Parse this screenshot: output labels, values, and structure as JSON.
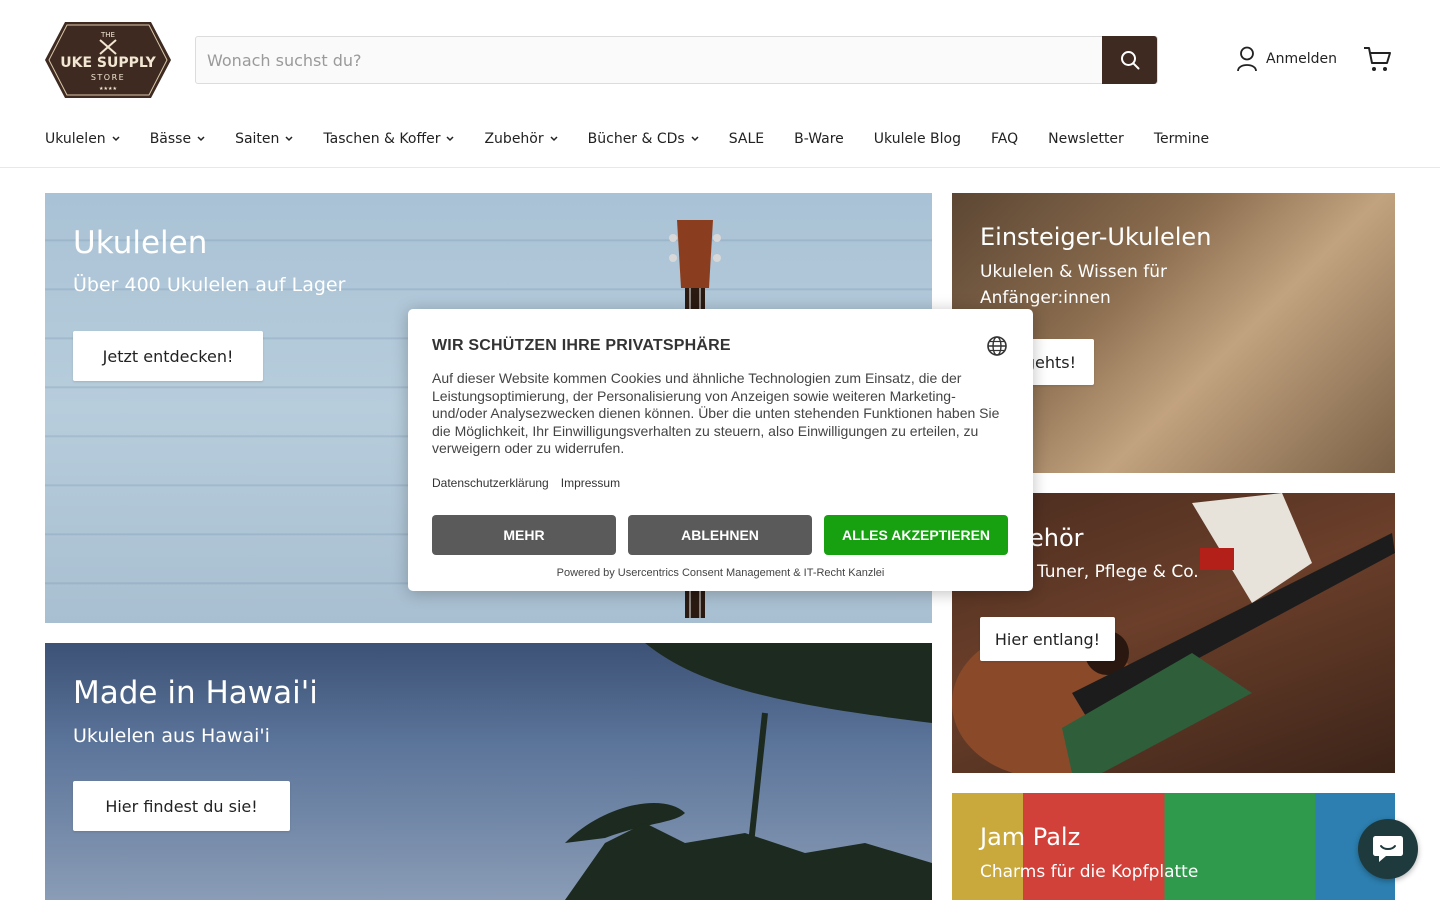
{
  "brand": {
    "logo_line1": "THE",
    "logo_line2": "UKE SUPPLY",
    "logo_line3": "STORE",
    "accent": "#3e2a21"
  },
  "search": {
    "placeholder": "Wonach suchst du?",
    "value": ""
  },
  "header": {
    "account_label": "Anmelden"
  },
  "nav": [
    {
      "label": "Ukulelen",
      "dropdown": true
    },
    {
      "label": "Bässe",
      "dropdown": true
    },
    {
      "label": "Saiten",
      "dropdown": true
    },
    {
      "label": "Taschen & Koffer",
      "dropdown": true
    },
    {
      "label": "Zubehör",
      "dropdown": true
    },
    {
      "label": "Bücher & CDs",
      "dropdown": true
    },
    {
      "label": "SALE",
      "dropdown": false
    },
    {
      "label": "B-Ware",
      "dropdown": false
    },
    {
      "label": "Ukulele Blog",
      "dropdown": false
    },
    {
      "label": "FAQ",
      "dropdown": false
    },
    {
      "label": "Newsletter",
      "dropdown": false
    },
    {
      "label": "Termine",
      "dropdown": false
    }
  ],
  "tiles": {
    "ukulelen": {
      "title": "Ukulelen",
      "subtitle": "Über 400 Ukulelen auf Lager",
      "button": "Jetzt entdecken!"
    },
    "einsteiger": {
      "title": "Einsteiger-Ukulelen",
      "subtitle_line1": "Ukulelen & Wissen für",
      "subtitle_line2": "Anfänger:innen",
      "button_visible": "gehts!"
    },
    "zubehoer": {
      "title_visible": "ehör",
      "subtitle_visible": "Tuner, Pflege & Co.",
      "button": "Hier entlang!"
    },
    "hawaii": {
      "title": "Made in Hawai'i",
      "subtitle": "Ukulelen aus Hawai'i",
      "button": "Hier findest du sie!"
    },
    "jampalz": {
      "title": "Jam Palz",
      "subtitle": "Charms für die Kopfplatte"
    }
  },
  "consent": {
    "title": "WIR SCHÜTZEN IHRE PRIVATSPHÄRE",
    "text": "Auf dieser Website kommen Cookies und ähnliche Technologien zum Einsatz, die der Leistungsoptimierung, der Personalisierung von Anzeigen sowie weiteren Marketing- und/oder Analysezwecken dienen können. Über die unten stehenden Funktionen haben Sie die Möglichkeit, Ihr Einwilligungsverhalten zu steuern, also Einwilligungen zu erteilen, zu verweigern oder zu widerrufen.",
    "link_privacy": "Datenschutzerklärung",
    "link_imprint": "Impressum",
    "btn_more": "MEHR",
    "btn_decline": "ABLEHNEN",
    "btn_accept": "ALLES AKZEPTIEREN",
    "footer": "Powered by Usercentrics Consent Management & IT-Recht Kanzlei",
    "colors": {
      "grey_button": "#5a5a5a",
      "accept_button": "#17a111"
    }
  }
}
